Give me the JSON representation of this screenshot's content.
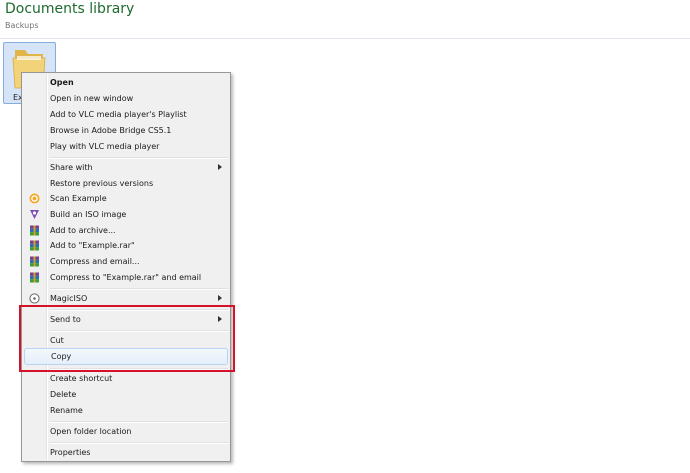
{
  "header": {
    "title": "Documents library",
    "subtitle": "Backups"
  },
  "file": {
    "name": "Exa"
  },
  "context_menu": {
    "open": "Open",
    "open_new_window": "Open in new window",
    "add_vlc_playlist": "Add to VLC media player's Playlist",
    "browse_bridge": "Browse in Adobe Bridge CS5.1",
    "play_vlc": "Play with VLC media player",
    "share_with": "Share with",
    "restore_versions": "Restore previous versions",
    "scan": "Scan Example",
    "build_iso": "Build an ISO image",
    "add_archive": "Add to archive...",
    "add_rar": "Add to \"Example.rar\"",
    "compress_email": "Compress and email...",
    "compress_rar_email": "Compress to \"Example.rar\" and email",
    "magiciso": "MagicISO",
    "send_to": "Send to",
    "cut": "Cut",
    "copy": "Copy",
    "create_shortcut": "Create shortcut",
    "delete": "Delete",
    "rename": "Rename",
    "open_folder_location": "Open folder location",
    "properties": "Properties"
  },
  "icons": {
    "scan": "scan-icon",
    "iso": "iso-icon",
    "winrar": "winrar-icon",
    "magiciso": "magiciso-icon",
    "folder": "folder-icon"
  },
  "colors": {
    "title_green": "#1e6b2f",
    "highlight_red": "#d4132b",
    "selection_blue": "#d5e5f7"
  }
}
